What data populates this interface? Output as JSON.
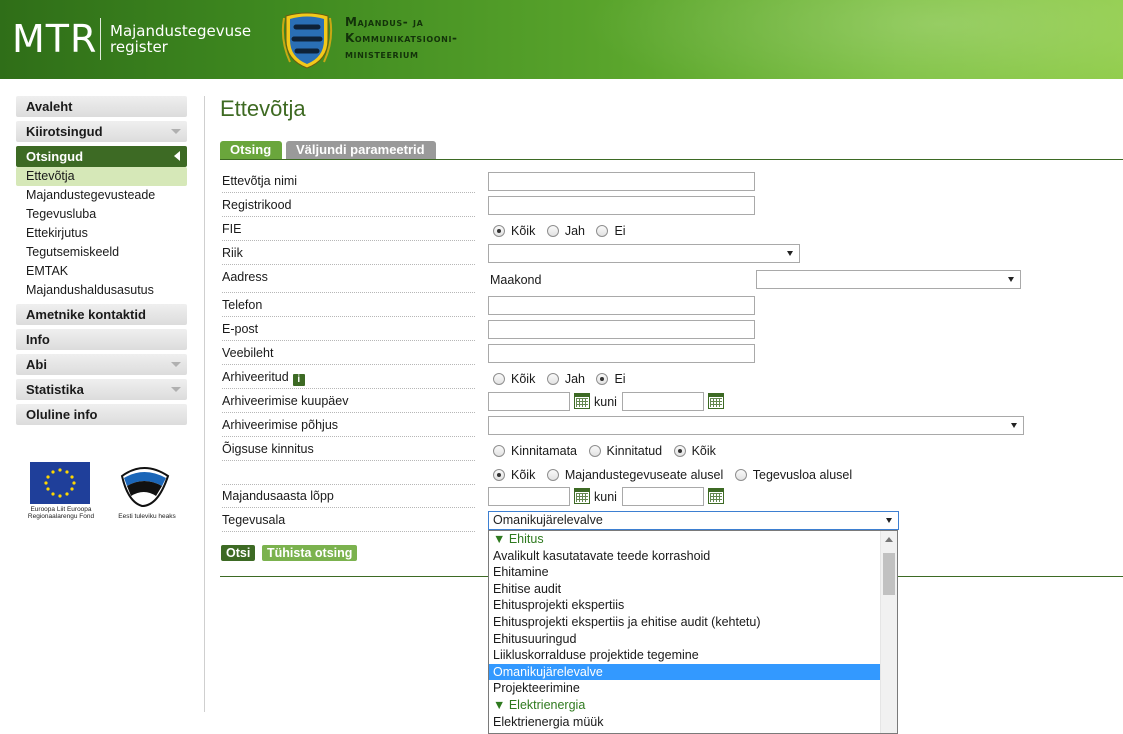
{
  "header": {
    "logo_main": "MTR",
    "logo_sub_line1": "Majandustegevuse",
    "logo_sub_line2": "register",
    "ministry_line1": "Majandus- ja",
    "ministry_line2": "Kommunikatsiooni-",
    "ministry_line3": "ministeerium"
  },
  "sidebar": {
    "items": [
      {
        "label": "Avaleht"
      },
      {
        "label": "Kiirotsingud"
      },
      {
        "label": "Otsingud"
      },
      {
        "label": "Ametnike kontaktid"
      },
      {
        "label": "Info"
      },
      {
        "label": "Abi"
      },
      {
        "label": "Statistika"
      },
      {
        "label": "Oluline info"
      }
    ],
    "sub_items": [
      {
        "label": "Ettevõtja"
      },
      {
        "label": "Majandustegevusteade"
      },
      {
        "label": "Tegevusluba"
      },
      {
        "label": "Ettekirjutus"
      },
      {
        "label": "Tegutsemiskeeld"
      },
      {
        "label": "EMTAK"
      },
      {
        "label": "Majandushaldusasutus"
      }
    ],
    "footer": {
      "eu_text": "Euroopa Liit Euroopa Regionaalarengu Fond",
      "ee_text": "Eesti tuleviku heaks"
    }
  },
  "main": {
    "title": "Ettevõtja",
    "tabs": [
      {
        "label": "Otsing"
      },
      {
        "label": "Väljundi parameetrid"
      }
    ],
    "fields": {
      "ettevotja_nimi": "Ettevõtja nimi",
      "registrikood": "Registrikood",
      "fie": "FIE",
      "riik": "Riik",
      "aadress": "Aadress",
      "maakond": "Maakond",
      "telefon": "Telefon",
      "epost": "E-post",
      "veebileht": "Veebileht",
      "arhiveeritud": "Arhiveeritud",
      "arhiveerimise_kuupaev": "Arhiveerimise kuupäev",
      "arhiveerimise_pohjus": "Arhiveerimise põhjus",
      "oigsuse_kinnitus": "Õigsuse kinnitus",
      "majandusaasta_lopp": "Majandusaasta lõpp",
      "tegevusala": "Tegevusala",
      "kuni": "kuni"
    },
    "radios": {
      "fie": [
        "Kõik",
        "Jah",
        "Ei"
      ],
      "arhiveeritud": [
        "Kõik",
        "Jah",
        "Ei"
      ],
      "oigsus": [
        "Kinnitamata",
        "Kinnitatud",
        "Kõik"
      ],
      "alus": [
        "Kõik",
        "Majandustegevuseate alusel",
        "Tegevusloa alusel"
      ]
    },
    "tegevusala_selected": "Omanikujärelevalve",
    "info_icon": "i",
    "buttons": {
      "search": "Otsi",
      "clear": "Tühista otsing"
    }
  },
  "dropdown": {
    "items": [
      {
        "label": "▼ Ehitus"
      },
      {
        "label": "Avalikult kasutatavate teede korrashoid"
      },
      {
        "label": "Ehitamine"
      },
      {
        "label": "Ehitise audit"
      },
      {
        "label": "Ehitusprojekti ekspertiis"
      },
      {
        "label": "Ehitusprojekti ekspertiis ja ehitise audit (kehtetu)"
      },
      {
        "label": "Ehitusuuringud"
      },
      {
        "label": "Liikluskorralduse projektide tegemine"
      },
      {
        "label": "Omanikujärelevalve"
      },
      {
        "label": "Projekteerimine"
      },
      {
        "label": "▼ Elektrienergia"
      },
      {
        "label": "Elektrienergia müük"
      }
    ]
  },
  "colors": {
    "brand_green": "#3d6a24",
    "tab_active": "#6aa63c",
    "highlight": "#3399ff"
  }
}
